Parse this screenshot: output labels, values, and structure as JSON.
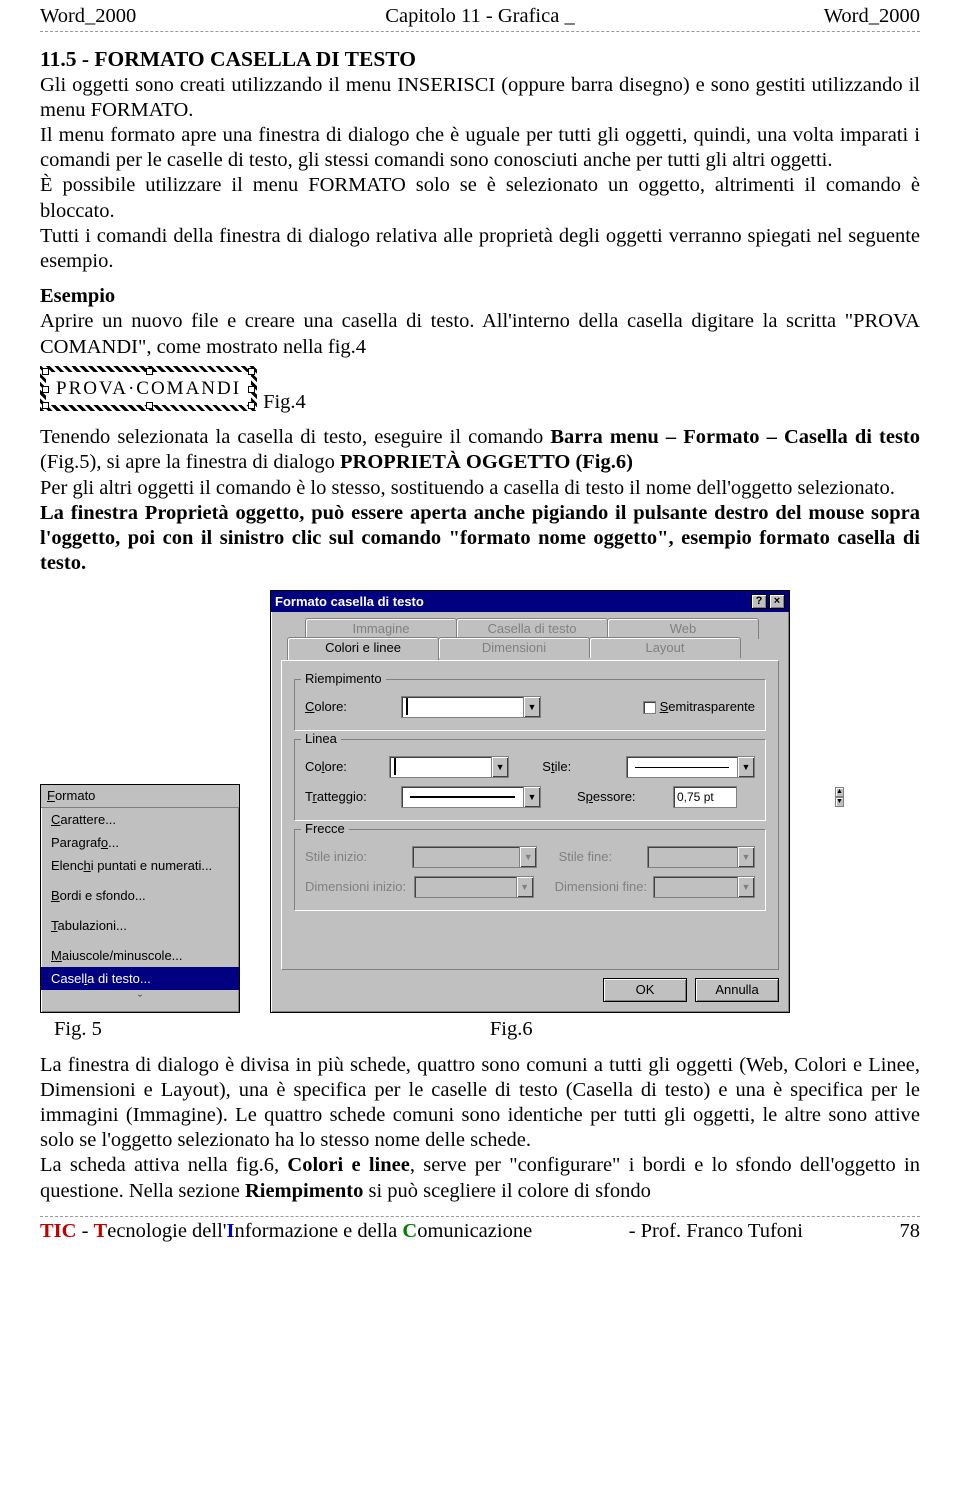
{
  "header": {
    "left": "Word_2000",
    "center_a": "Capitolo 11",
    "center_sep": "  -  ",
    "center_b": "Grafica",
    "center_c": " _",
    "right": "Word_2000"
  },
  "section_title": "11.5 - FORMATO CASELLA DI TESTO",
  "para1": "Gli oggetti sono creati utilizzando il menu INSERISCI (oppure barra disegno) e sono gestiti utilizzando il menu FORMATO.",
  "para2": "Il menu formato apre una finestra di dialogo che è uguale per tutti gli oggetti, quindi, una volta imparati i comandi per le caselle di testo, gli stessi comandi sono conosciuti anche per tutti gli altri oggetti.",
  "para3": "È possibile utilizzare il menu FORMATO solo se è selezionato un oggetto, altrimenti il comando è bloccato.",
  "para4": "Tutti i comandi della finestra di dialogo relativa alle proprietà degli oggetti verranno spiegati nel seguente esempio.",
  "esempio_label": "Esempio",
  "esempio_text_a": "Aprire un nuovo file e creare una casella di testo. All'interno della casella digitare la scritta \"PROVA COMANDI\", come mostrato nella fig.4",
  "textbox_value": "PROVA·COMANDI",
  "fig4_label": "Fig.4",
  "para5_a": "Tenendo selezionata la casella di testo, eseguire il comando ",
  "para5_b": "Barra menu – Formato – Casella di testo",
  "para5_c": " (Fig.5), si apre la finestra di dialogo ",
  "para5_d": "PROPRIETÀ OGGETTO (Fig.6)",
  "para6": "Per gli altri oggetti il comando è lo stesso, sostituendo a casella di testo il nome dell'oggetto selezionato.",
  "para7": "La finestra Proprietà oggetto, può essere aperta anche pigiando il pulsante destro del mouse sopra l'oggetto, poi con il sinistro clic sul comando \"formato nome oggetto\", esempio formato casella di testo.",
  "menu": {
    "title": "Formato",
    "items": [
      {
        "html": "<u>C</u>arattere..."
      },
      {
        "html": "Paragraf<u>o</u>..."
      },
      {
        "html": "Elenc<u>h</u>i puntati e numerati..."
      },
      {
        "html": "<u>B</u>ordi e sfondo..."
      },
      {
        "html": "<u>T</u>abulazioni..."
      },
      {
        "html": "<u>M</u>aiuscole/minuscole..."
      },
      {
        "html": "Casel<u>l</u>a di testo...",
        "selected": true
      }
    ],
    "more": "ˇ"
  },
  "dialog": {
    "title": "Formato casella di testo",
    "tabs_back": [
      "Immagine",
      "Casella di testo",
      "Web"
    ],
    "tabs_front": [
      "Colori e linee",
      "Dimensioni",
      "Layout"
    ],
    "group_fill": "Riempimento",
    "fill_color": "Colore:",
    "semitransp": "Semitrasparente",
    "group_line": "Linea",
    "line_color": "Colore:",
    "line_style": "Stile:",
    "line_dash": "Tratteggio:",
    "line_weight": "Spessore:",
    "weight_val": "0,75 pt",
    "group_arrows": "Frecce",
    "arrow_ss": "Stile inizio:",
    "arrow_se": "Stile fine:",
    "arrow_ds": "Dimensioni inizio:",
    "arrow_de": "Dimensioni fine:",
    "ok": "OK",
    "cancel": "Annulla"
  },
  "fig5_label": "Fig. 5",
  "fig6_label": "Fig.6",
  "para8_a": "La finestra di dialogo è divisa in più schede, quattro sono comuni a tutti gli oggetti (Web, Colori e Linee, Dimensioni e Layout), una è specifica per le caselle di testo (Casella di testo) e una è specifica per le immagini (Immagine). Le quattro schede comuni sono identiche per tutti gli oggetti, le altre sono attive solo se l'oggetto selezionato ha lo stesso nome delle schede.",
  "para8_b_a": "La scheda attiva nella fig.6, ",
  "para8_b_b": "Colori e linee",
  "para8_b_c": ", serve per \"configurare\" i bordi e lo sfondo dell'oggetto in questione. Nella sezione ",
  "para8_b_d": "Riempimento",
  "para8_b_e": " si può scegliere il colore di sfondo",
  "footer": {
    "tic": "TIC",
    "dash": " - ",
    "t": "T",
    "ecnologie": "ecnologie dell'",
    "i": "I",
    "nformazione": "nformazione e della ",
    "c": "C",
    "omunicazione": "omunicazione",
    "sep": "   -   ",
    "prof": "Prof.  Franco Tufoni",
    "page": "78"
  }
}
